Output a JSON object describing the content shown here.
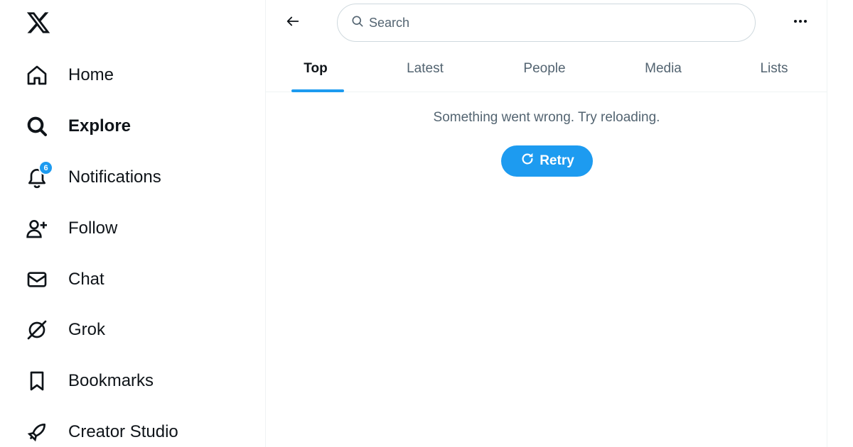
{
  "sidebar": {
    "logo": "x-logo-icon",
    "items": [
      {
        "label": "Home",
        "icon": "home-icon",
        "active": false
      },
      {
        "label": "Explore",
        "icon": "search-icon",
        "active": true
      },
      {
        "label": "Notifications",
        "icon": "bell-icon",
        "active": false,
        "badge": "6"
      },
      {
        "label": "Follow",
        "icon": "person-add-icon",
        "active": false
      },
      {
        "label": "Chat",
        "icon": "envelope-icon",
        "active": false
      },
      {
        "label": "Grok",
        "icon": "grok-icon",
        "active": false
      },
      {
        "label": "Bookmarks",
        "icon": "bookmark-icon",
        "active": false
      },
      {
        "label": "Creator Studio",
        "icon": "rocket-icon",
        "active": false
      }
    ]
  },
  "header": {
    "back_icon": "back-arrow-icon",
    "search": {
      "placeholder": "Search",
      "value": ""
    },
    "more_icon": "more-dots-icon"
  },
  "tabs": [
    {
      "label": "Top",
      "active": true
    },
    {
      "label": "Latest",
      "active": false
    },
    {
      "label": "People",
      "active": false
    },
    {
      "label": "Media",
      "active": false
    },
    {
      "label": "Lists",
      "active": false
    }
  ],
  "content": {
    "error_message": "Something went wrong. Try reloading.",
    "retry_label": "Retry"
  },
  "colors": {
    "accent": "#1d9bf0",
    "text_primary": "#0f1419",
    "text_secondary": "#536471",
    "border": "#eff3f4"
  }
}
